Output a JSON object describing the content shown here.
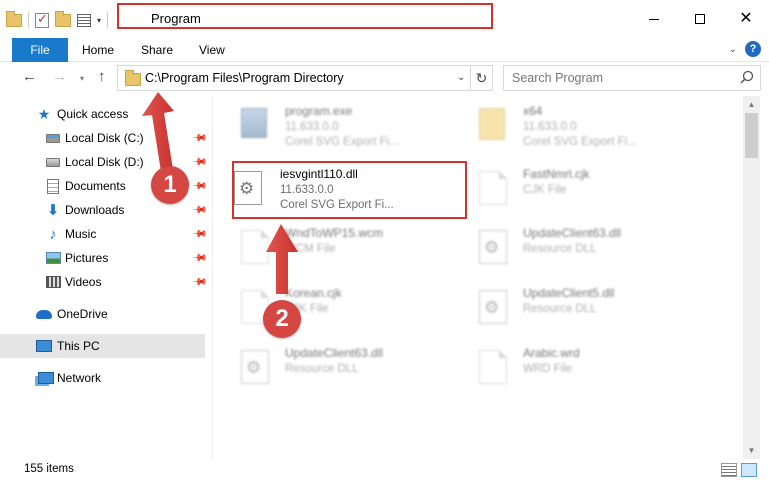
{
  "window": {
    "title": "Program"
  },
  "ribbon": {
    "tabs": [
      "File",
      "Home",
      "Share",
      "View"
    ],
    "help_label": "?"
  },
  "nav": {
    "address_path": "C:\\Program Files\\Program Directory",
    "search_placeholder": "Search Program"
  },
  "sidebar": {
    "items": [
      {
        "label": "Quick access",
        "icon": "star-icon",
        "pinned": false
      },
      {
        "label": "Local Disk (C:)",
        "icon": "local-disk-icon",
        "pinned": true
      },
      {
        "label": "Local Disk (D:)",
        "icon": "local-disk-icon",
        "pinned": true
      },
      {
        "label": "Documents",
        "icon": "documents-icon",
        "pinned": true
      },
      {
        "label": "Downloads",
        "icon": "downloads-icon",
        "pinned": true
      },
      {
        "label": "Music",
        "icon": "music-icon",
        "pinned": true
      },
      {
        "label": "Pictures",
        "icon": "pictures-icon",
        "pinned": true
      },
      {
        "label": "Videos",
        "icon": "videos-icon",
        "pinned": true
      },
      {
        "label": "OneDrive",
        "icon": "onedrive-icon",
        "pinned": false
      },
      {
        "label": "This PC",
        "icon": "this-pc-icon",
        "pinned": false,
        "selected": true
      },
      {
        "label": "Network",
        "icon": "network-icon",
        "pinned": false
      }
    ]
  },
  "files": [
    {
      "name": "program.exe",
      "line1": "11.633.0.0",
      "line2": "Corel SVG Export Fi...",
      "icon": "exe-file-icon",
      "blurred": true
    },
    {
      "name": "x64",
      "line1": "11.633.0.0",
      "line2": "Corel SVG Export Fi...",
      "icon": "zip-folder-icon",
      "blurred": true
    },
    {
      "name": "iesvgintl110.dll",
      "line1": "11.633.0.0",
      "line2": "Corel SVG Export Fi...",
      "icon": "dll-gear-icon",
      "blurred": false,
      "highlighted": true
    },
    {
      "name": "FastNmrl.cjk",
      "line1": "CJK File",
      "line2": "",
      "icon": "generic-file-icon",
      "blurred": true
    },
    {
      "name": "WndToWP15.wcm",
      "line1": "WCM File",
      "line2": "",
      "icon": "generic-file-icon",
      "blurred": true
    },
    {
      "name": "UpdateClient63.dll",
      "line1": "Resource DLL",
      "line2": "",
      "icon": "dll-gear-icon",
      "blurred": true
    },
    {
      "name": "Korean.cjk",
      "line1": "CJK File",
      "line2": "",
      "icon": "generic-file-icon",
      "blurred": true
    },
    {
      "name": "UpdateClient5.dll",
      "line1": "Resource DLL",
      "line2": "",
      "icon": "dll-gear-icon",
      "blurred": true
    },
    {
      "name": "UpdateClient63.dll",
      "line1": "Resource DLL",
      "line2": "",
      "icon": "dll-gear-icon",
      "blurred": true
    },
    {
      "name": "Arabic.wrd",
      "line1": "WRD File",
      "line2": "",
      "icon": "generic-file-icon",
      "blurred": true
    }
  ],
  "status": {
    "item_count": "155 items"
  },
  "annotations": {
    "callout_1": "1",
    "callout_2": "2",
    "color": "#d5312f"
  }
}
